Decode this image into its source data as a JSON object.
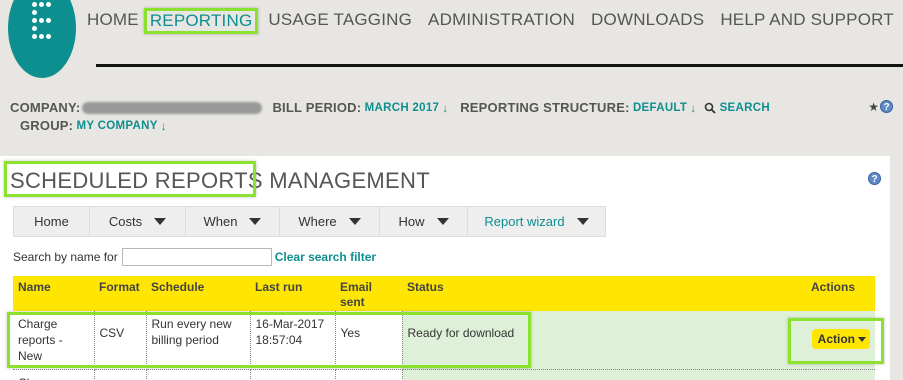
{
  "nav": {
    "items": [
      "HOME",
      "REPORTING",
      "USAGE TAGGING",
      "ADMINISTRATION",
      "DOWNLOADS",
      "HELP AND SUPPORT"
    ],
    "active": "REPORTING"
  },
  "company_bar": {
    "company_label": "COMPANY:",
    "bill_period_label": "BILL PERIOD:",
    "bill_period_value": "MARCH 2017",
    "structure_label": "REPORTING STRUCTURE:",
    "structure_value": "DEFAULT",
    "search_label": "SEARCH",
    "group_label": "GROUP:",
    "group_value": "MY COMPANY"
  },
  "page": {
    "title": "SCHEDULED REPORTS MANAGEMENT"
  },
  "menu": {
    "items": [
      {
        "label": "Home",
        "dropdown": false
      },
      {
        "label": "Costs",
        "dropdown": true
      },
      {
        "label": "When",
        "dropdown": true
      },
      {
        "label": "Where",
        "dropdown": true
      },
      {
        "label": "How",
        "dropdown": true
      },
      {
        "label": "Report wizard",
        "dropdown": true
      }
    ]
  },
  "search": {
    "label": "Search by name for",
    "value": "",
    "clear_label": "Clear search filter"
  },
  "table": {
    "columns": [
      "Name",
      "Format",
      "Schedule",
      "Last run",
      "Email sent",
      "Status",
      "Actions"
    ],
    "rows": [
      {
        "name": "Charge reports - New",
        "format": "CSV",
        "schedule": "Run every new billing period",
        "last_run": "16-Mar-2017 18:57:04",
        "email_sent": "Yes",
        "status": "Ready for download",
        "action_label": "Action"
      },
      {
        "name": "Charge",
        "format": "",
        "schedule": "",
        "last_run": "",
        "email_sent": "",
        "status": "",
        "action_label": ""
      }
    ]
  },
  "colors": {
    "brand_teal": "#0e8f8f",
    "highlight_green": "#8ae22f",
    "header_yellow": "#ffe600",
    "status_green": "#dff0d8"
  }
}
